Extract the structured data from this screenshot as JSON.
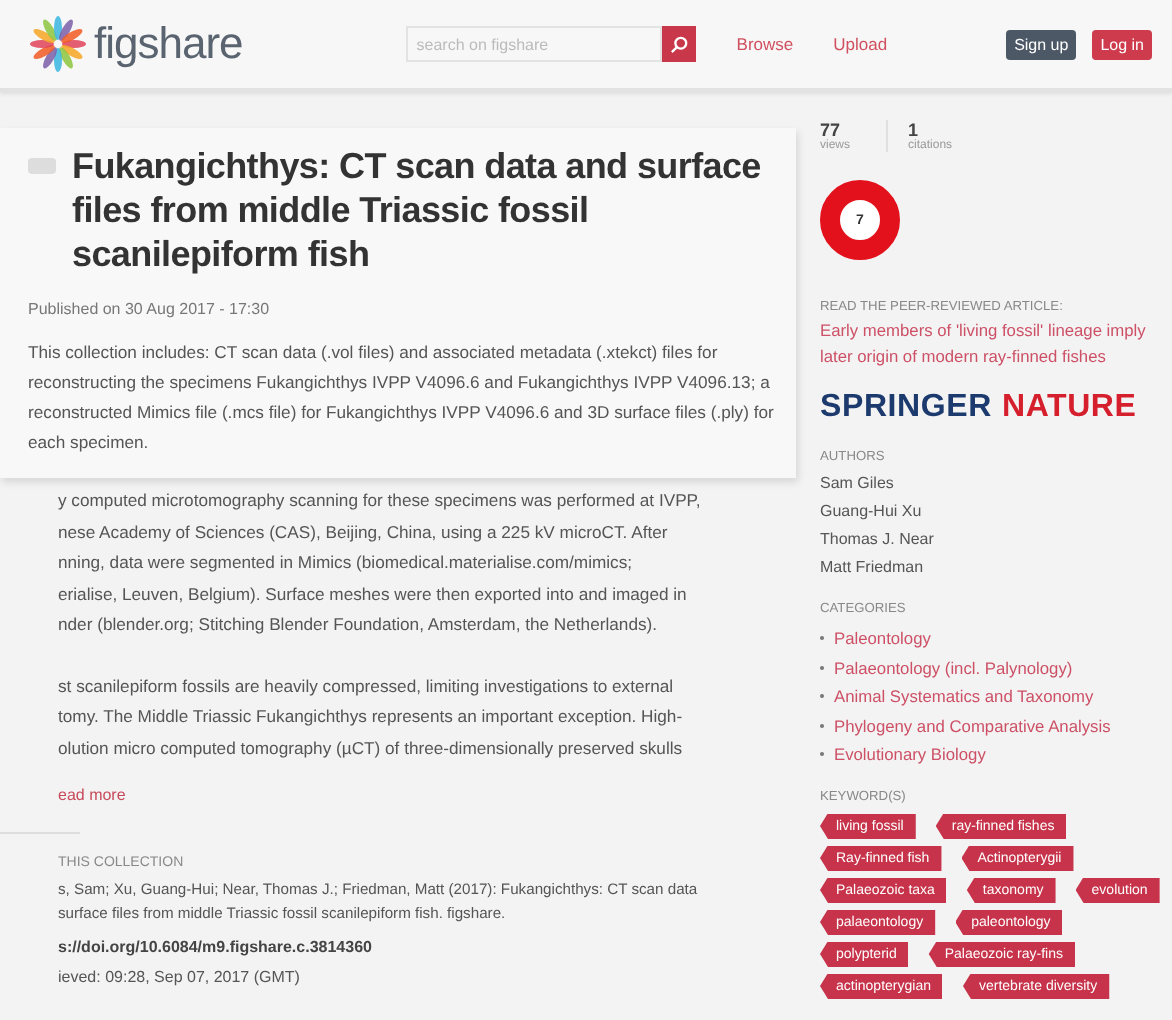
{
  "header": {
    "logo": "figshare",
    "search": {
      "placeholder": "search on figshare"
    },
    "nav": [
      "Browse",
      "Upload"
    ],
    "buttons": [
      {
        "label": "Sign up",
        "kind": "secondary"
      },
      {
        "label": "Log in",
        "kind": "primary"
      }
    ]
  },
  "item": {
    "title": "Fukangichthys: CT scan data and surface files from middle Triassic fossil scanilepiform fish",
    "published": "Published on 30 Aug 2017 - 17:30",
    "description": "This collection includes: CT scan data (.vol files) and associated metadata (.xtekct) files for reconstructing the specimens Fukangichthys IVPP V4096.6 and Fukangichthys IVPP V4096.13; a reconstructed Mimics file (.mcs file) for Fukangichthys IVPP V4096.6 and 3D surface files (.ply) for each specimen."
  },
  "body": [
    [
      "y computed microtomography scanning for these specimens was performed at IVPP,",
      "nese Academy of Sciences (CAS), Beijing, China, using a 225 kV microCT. After",
      "nning, data were segmented in Mimics (biomedical.materialise.com/mimics;",
      "erialise, Leuven, Belgium). Surface meshes were then exported into and imaged in",
      "nder (blender.org; Stitching Blender Foundation, Amsterdam, the Netherlands)."
    ],
    [
      "st scanilepiform fossils are heavily compressed, limiting investigations to external",
      "tomy. The Middle Triassic Fukangichthys represents an important exception. High-",
      "olution micro computed tomography (µCT) of three-dimensionally preserved skulls"
    ]
  ],
  "read_more": "ead more",
  "cite": {
    "heading": "THIS COLLECTION",
    "text": [
      "s, Sam; Xu, Guang-Hui; Near, Thomas J.; Friedman, Matt (2017): Fukangichthys: CT scan data",
      "surface files from middle Triassic fossil scanilepiform fish. figshare."
    ],
    "doi": "s://doi.org/10.6084/m9.figshare.c.3814360",
    "retrieved": "ieved: 09:28, Sep 07, 2017 (GMT)"
  },
  "stats": [
    {
      "value": "77",
      "label": "views"
    },
    {
      "value": "1",
      "label": "citations"
    }
  ],
  "altmetric": "7",
  "peer": {
    "heading": "READ THE PEER-REVIEWED ARTICLE:",
    "link": "Early members of 'living fossil' lineage imply later origin of modern ray-finned fishes",
    "publisher": [
      "SPRINGER",
      "NATURE"
    ]
  },
  "authors": {
    "heading": "AUTHORS",
    "names": [
      "Sam Giles",
      "Guang-Hui Xu",
      "Thomas J. Near",
      "Matt Friedman"
    ]
  },
  "categories": {
    "heading": "CATEGORIES",
    "items": [
      "Paleontology",
      "Palaeontology (incl. Palynology)",
      "Animal Systematics and Taxonomy",
      "Phylogeny and Comparative Analysis",
      "Evolutionary Biology"
    ]
  },
  "keywords": {
    "heading": "KEYWORD(S)",
    "rows": [
      [
        "living fossil",
        "ray-finned fishes"
      ],
      [
        "Ray-finned fish",
        "Actinopterygii"
      ],
      [
        "Palaeozoic taxa",
        "taxonomy",
        "evolution"
      ],
      [
        "palaeontology",
        "paleontology"
      ],
      [
        "polypterid",
        "Palaeozoic ray-fins"
      ],
      [
        "actinopterygian",
        "vertebrate diversity"
      ]
    ]
  }
}
